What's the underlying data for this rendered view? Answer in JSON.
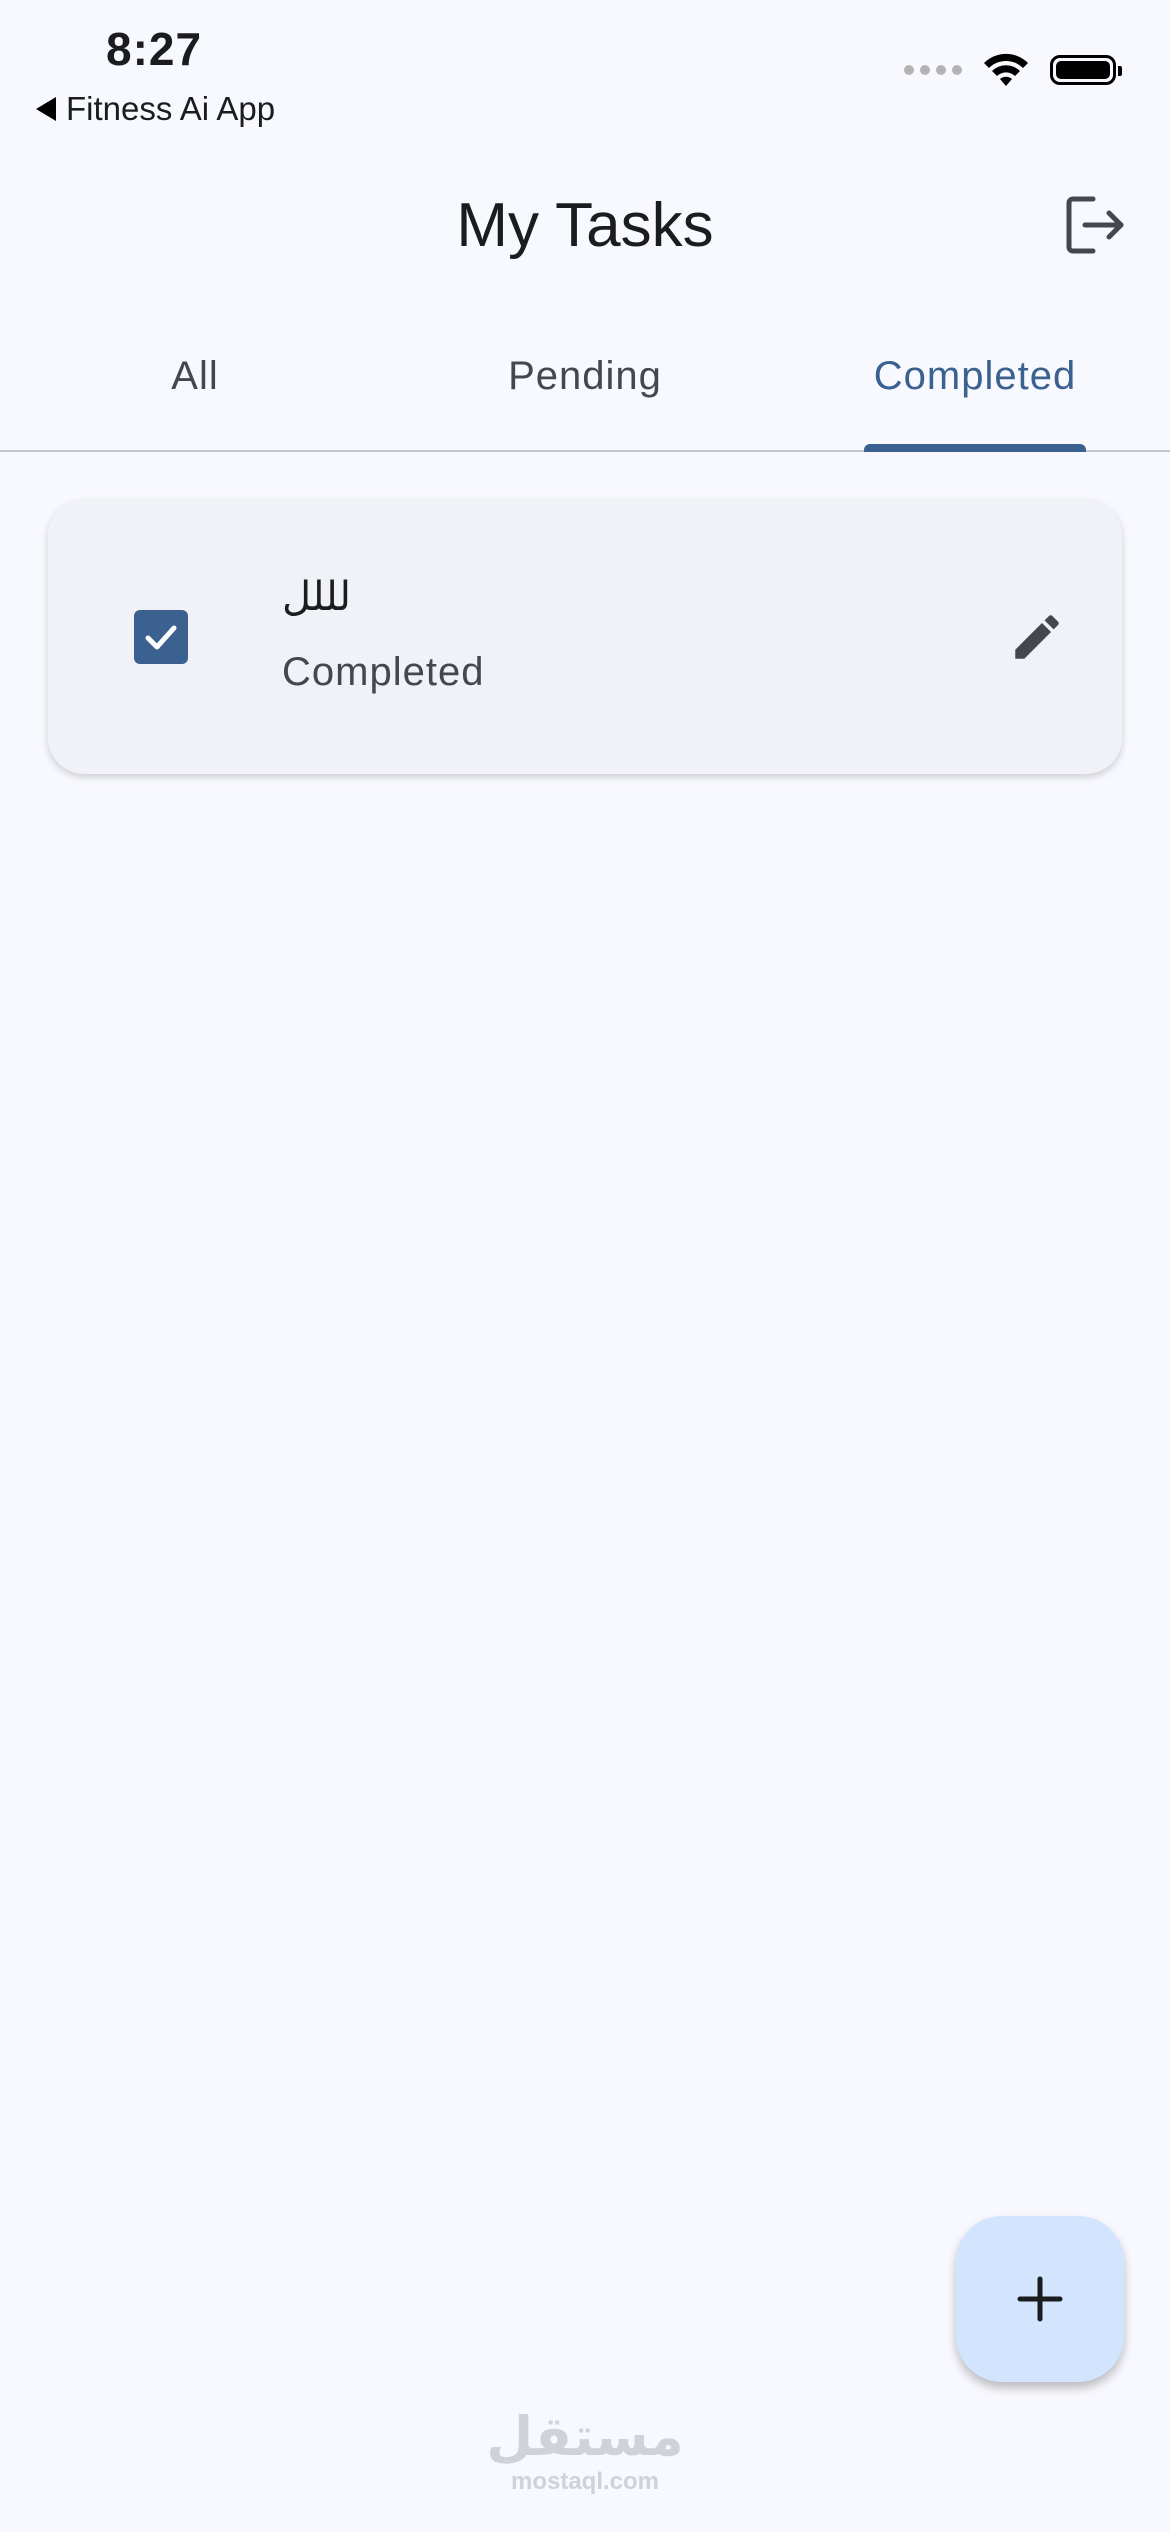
{
  "status_bar": {
    "time": "8:27",
    "back_app_label": "Fitness Ai App",
    "icons": [
      "cellular-signal-icon",
      "wifi-icon",
      "battery-icon"
    ]
  },
  "app_bar": {
    "title": "My Tasks",
    "logout_icon": "logout-icon"
  },
  "tabs": [
    {
      "label": "All",
      "active": false
    },
    {
      "label": "Pending",
      "active": false
    },
    {
      "label": "Completed",
      "active": true
    }
  ],
  "tasks": [
    {
      "title": "لللل",
      "status": "Completed",
      "checked": true
    }
  ],
  "fab": {
    "icon": "plus-icon"
  },
  "watermark": {
    "arabic": "مستقل",
    "latin": "mostaql.com"
  },
  "colors": {
    "background": "#f8f9fe",
    "primary": "#3a618f",
    "card": "#f1f2f8",
    "fab": "#d3e4ff",
    "on_surface": "#1b1c1f",
    "on_surface_variant": "#44474e"
  }
}
